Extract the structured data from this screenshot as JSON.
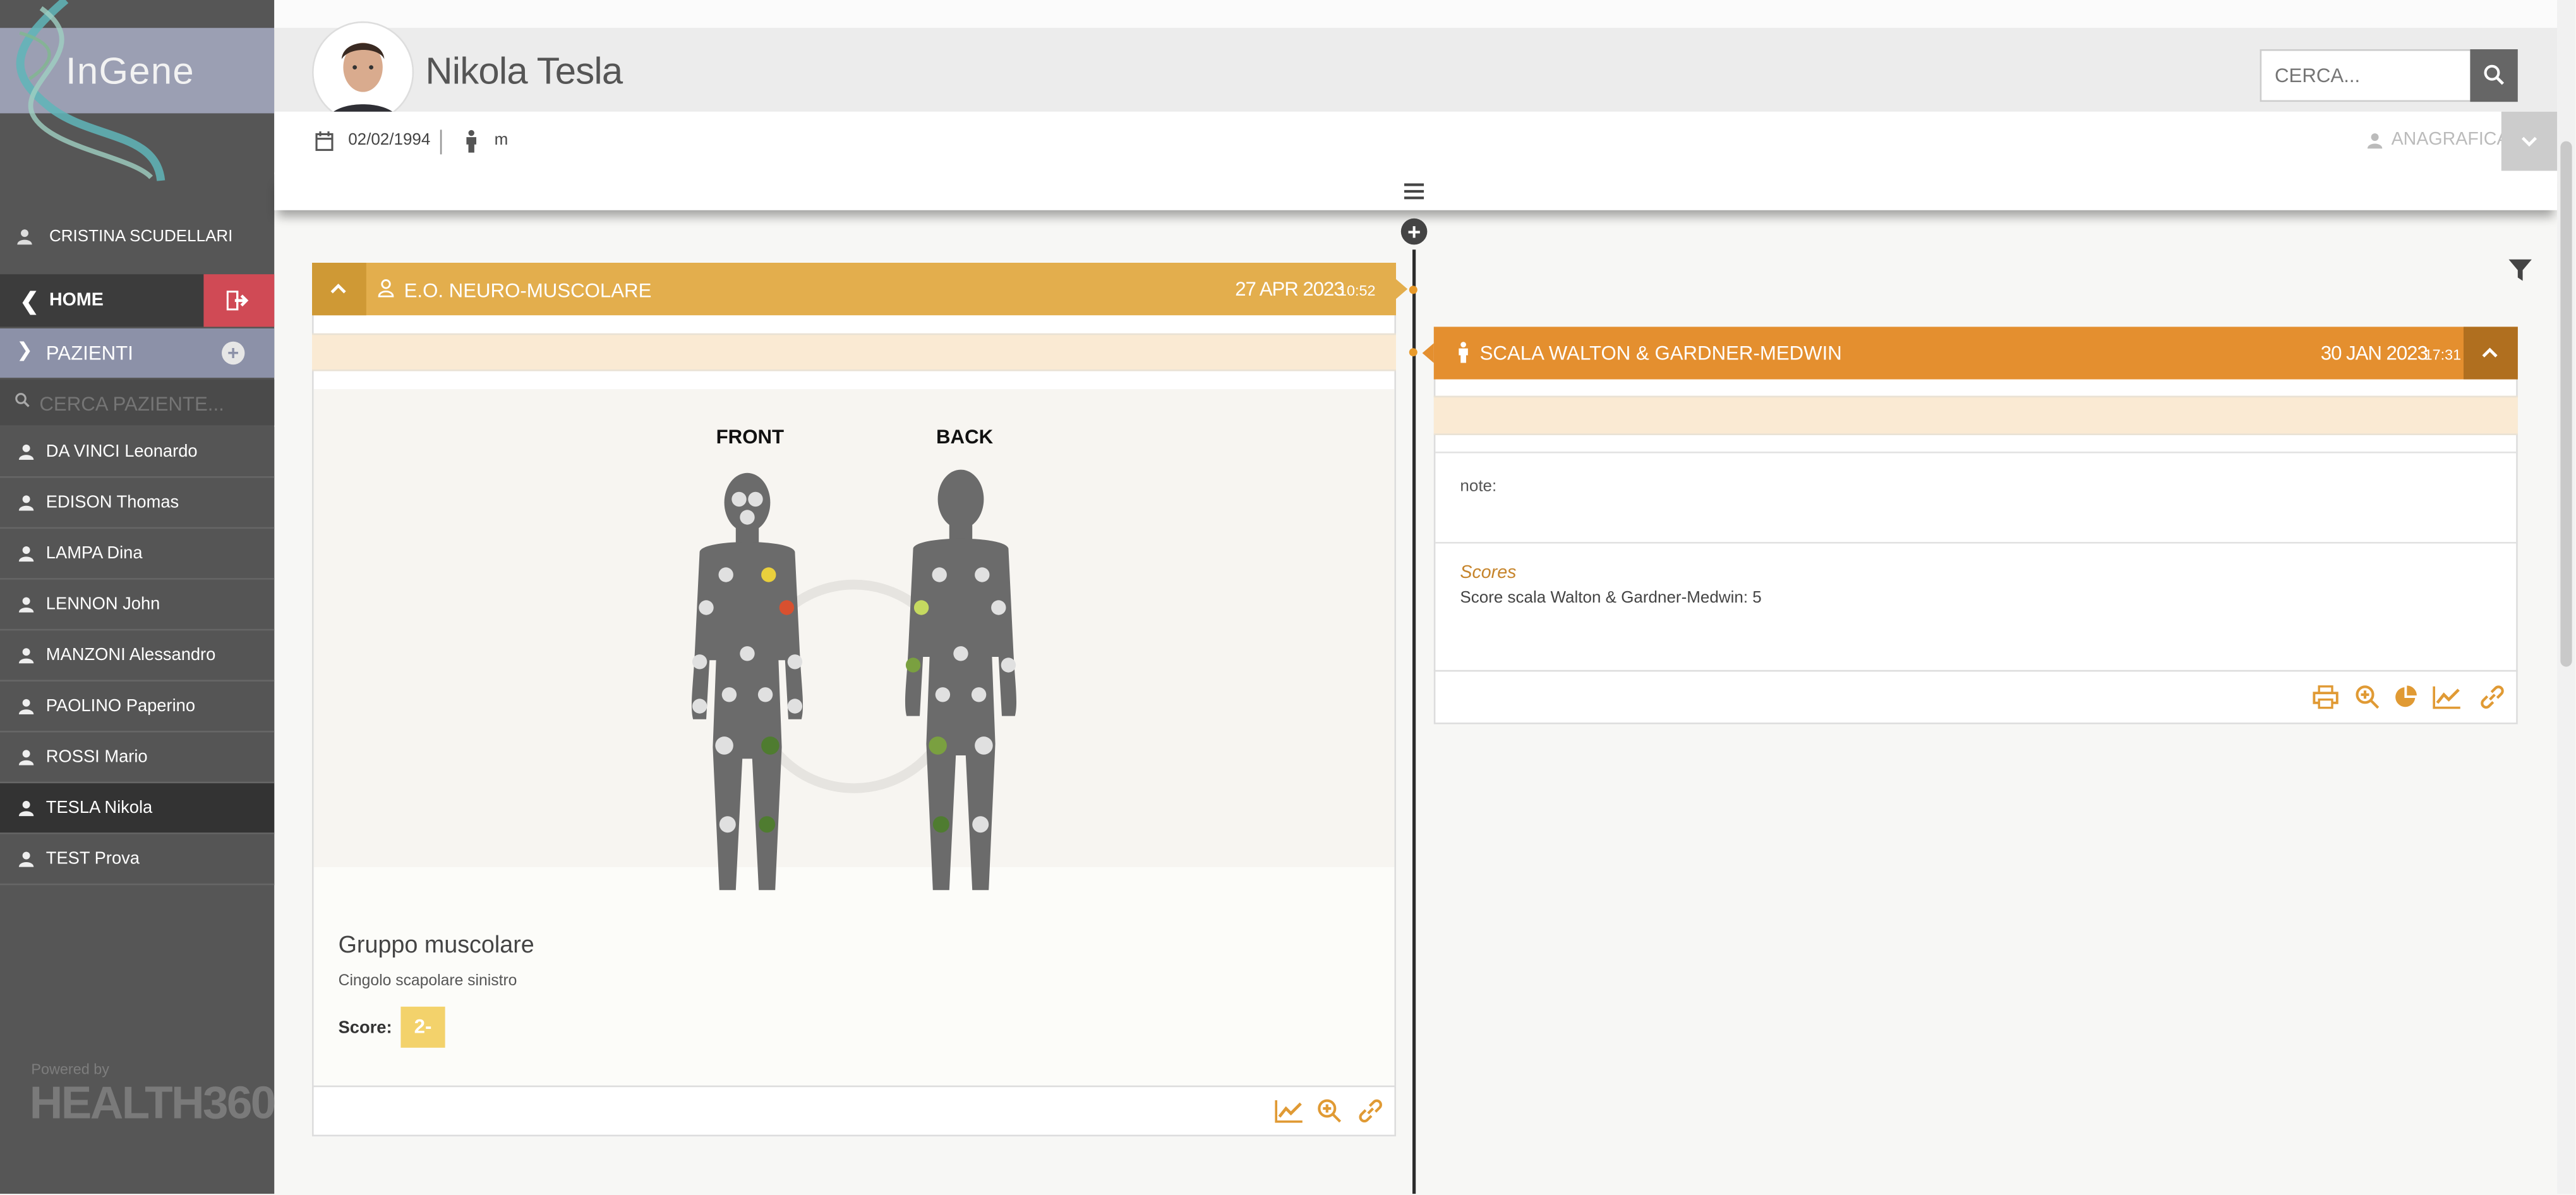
{
  "app": {
    "logo": "InGene",
    "powered_by": "Powered by",
    "footer_brand": "HEALTH360"
  },
  "sidebar": {
    "user": "CRISTINA SCUDELLARI",
    "home_label": "HOME",
    "pazienti_label": "PAZIENTI",
    "search_placeholder": "CERCA PAZIENTE...",
    "patients": [
      {
        "name": "DA VINCI Leonardo",
        "active": false
      },
      {
        "name": "EDISON Thomas",
        "active": false
      },
      {
        "name": "LAMPA Dina",
        "active": false
      },
      {
        "name": "LENNON John",
        "active": false
      },
      {
        "name": "MANZONI Alessandro",
        "active": false
      },
      {
        "name": "PAOLINO Paperino",
        "active": false
      },
      {
        "name": "ROSSI Mario",
        "active": false
      },
      {
        "name": "TESLA Nikola",
        "active": true
      },
      {
        "name": "TEST Prova",
        "active": false
      }
    ]
  },
  "header": {
    "patient_name": "Nikola Tesla",
    "search_placeholder": "CERCA...",
    "birthdate": "02/02/1994",
    "sex": "m",
    "anagrafica_label": "ANAGRAFICA"
  },
  "card_eo": {
    "title": "E.O. NEURO-MUSCOLARE",
    "date": "27 APR 2023",
    "time": "10:52",
    "front_label": "FRONT",
    "back_label": "BACK",
    "gruppo_title": "Gruppo muscolare",
    "gruppo_value": "Cingolo scapolare sinistro",
    "score_label": "Score:",
    "score_value": "2-",
    "colors": {
      "header": "#e3ae4d",
      "score_badge": "#f3d26b"
    }
  },
  "card_scala": {
    "title": "SCALA WALTON & GARDNER-MEDWIN",
    "date": "30 JAN 2023",
    "time": "17:31",
    "note_label": "note:",
    "scores_title": "Scores",
    "scores_value": "Score scala Walton & Gardner-Medwin: 5",
    "colors": {
      "header": "#e48f2f",
      "accent": "#c6842b"
    }
  }
}
